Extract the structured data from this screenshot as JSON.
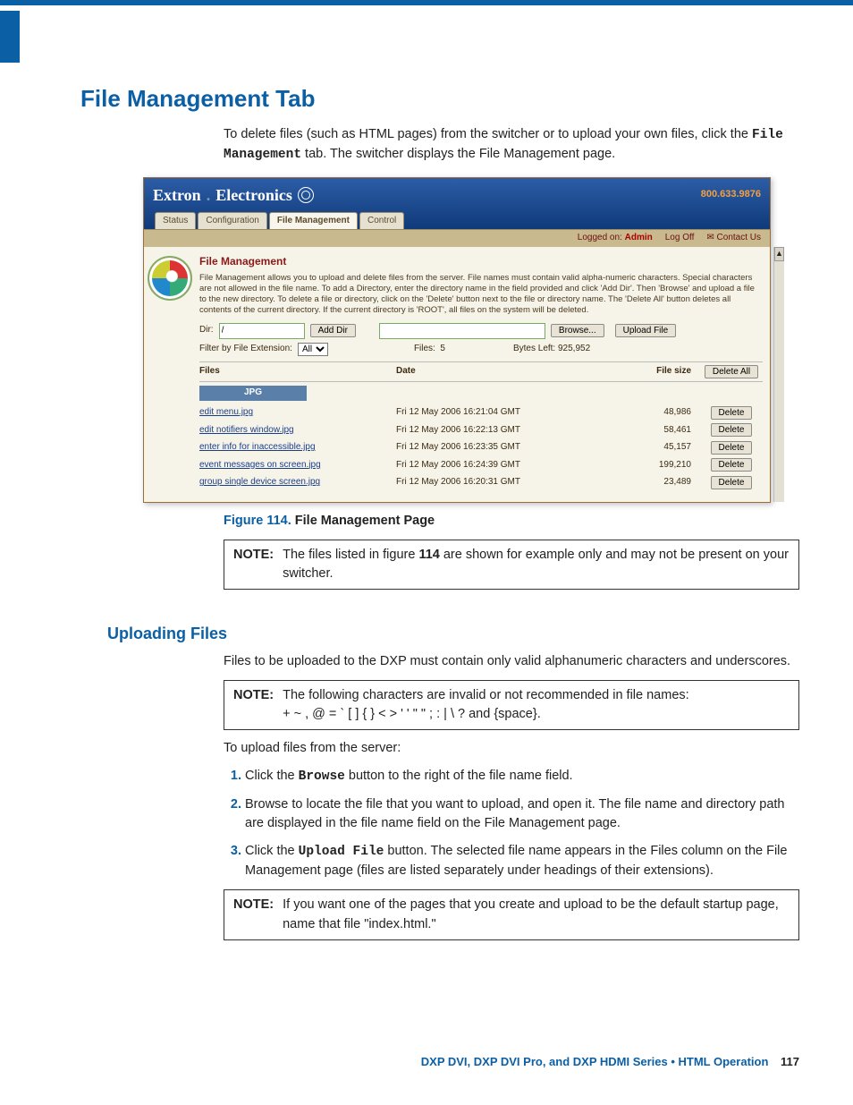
{
  "page": {
    "section_title": "File Management Tab",
    "intro_a": "To delete files (such as HTML pages) from the switcher or to upload your own files, click the ",
    "intro_mono": "File Management",
    "intro_b": " tab. The switcher displays the File Management page.",
    "fig_label": "Figure 114.",
    "fig_title": " File Management Page",
    "note1_label": "NOTE:",
    "note1_a": "The files listed in figure ",
    "note1_bold": "114",
    "note1_b": " are shown for example only and may not be present on your switcher.",
    "sub_title": "Uploading Files",
    "upload_intro": "Files to be uploaded to the DXP must contain only valid alphanumeric characters and underscores.",
    "note2_label": "NOTE:",
    "note2_line1": "The following characters are invalid or not recommended in file names:",
    "note2_line2": "+ ~ , @ = ` [ ] { } < > ' ' \" \" ; : | \\ ? and {space}.",
    "upload_lead": "To upload files from the server:",
    "steps": {
      "s1a": "Click the ",
      "s1mono": "Browse",
      "s1b": " button to the right of the file name field.",
      "s2": "Browse to locate the file that you want to upload, and open it. The file name and directory path are displayed in the file name field on the File Management page.",
      "s3a": "Click the ",
      "s3mono": "Upload File",
      "s3b": " button. The selected file name appears in the Files column on the File Management page (files are listed separately under headings of their extensions)."
    },
    "note3_label": "NOTE:",
    "note3": "If you want one of the pages that you create and upload to be the default startup page, name that file \"index.html.\""
  },
  "footer": {
    "text": "DXP DVI, DXP DVI Pro, and DXP HDMI Series • HTML Operation",
    "page_no": "117"
  },
  "embed": {
    "brand_a": "Extron",
    "brand_b": "Electronics",
    "phone": "800.633.9876",
    "tabs": [
      "Status",
      "Configuration",
      "File Management",
      "Control"
    ],
    "active_tab_index": 2,
    "logged_label": "Logged on:",
    "logged_user": "Admin",
    "logoff": "Log Off",
    "contact": "Contact Us",
    "panel_title": "File Management",
    "panel_desc": "File Management allows you to upload and delete files from the server. File names must contain valid alpha-numeric characters. Special characters are not allowed in the file name. To add a Directory, enter the directory name in the field provided and click 'Add Dir'. Then 'Browse' and upload a file to the new directory. To delete a file or directory, click on the 'Delete' button next to the file or directory name. The 'Delete All' button deletes all contents of the current directory. If the current directory is 'ROOT', all files on the system will be deleted.",
    "dir_label": "Dir:",
    "dir_value": "/",
    "add_dir_btn": "Add Dir",
    "browse_btn": "Browse...",
    "upload_btn": "Upload File",
    "filter_label": "Filter by File Extension:",
    "filter_value": "All",
    "files_label": "Files:",
    "files_count": "5",
    "bytes_label": "Bytes Left:",
    "bytes_value": "925,952",
    "col_files": "Files",
    "col_date": "Date",
    "col_size": "File size",
    "delete_all_btn": "Delete All",
    "group_hdr": "JPG",
    "delete_btn": "Delete",
    "rows": [
      {
        "name": "edit menu.jpg",
        "date": "Fri 12 May 2006 16:21:04 GMT",
        "size": "48,986"
      },
      {
        "name": "edit notifiers window.jpg",
        "date": "Fri 12 May 2006 16:22:13 GMT",
        "size": "58,461"
      },
      {
        "name": "enter info for inaccessible.jpg",
        "date": "Fri 12 May 2006 16:23:35 GMT",
        "size": "45,157"
      },
      {
        "name": "event messages on screen.jpg",
        "date": "Fri 12 May 2006 16:24:39 GMT",
        "size": "199,210"
      },
      {
        "name": "group single device screen.jpg",
        "date": "Fri 12 May 2006 16:20:31 GMT",
        "size": "23,489"
      }
    ]
  }
}
